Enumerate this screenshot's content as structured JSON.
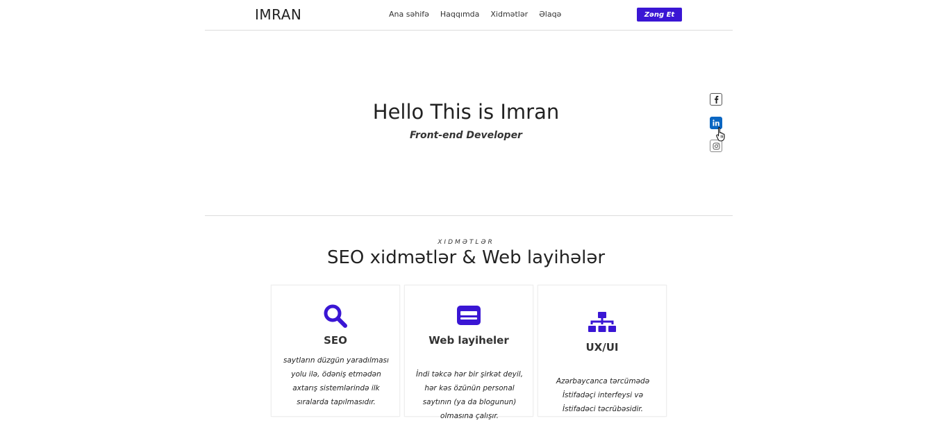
{
  "header": {
    "logo": "IMRAN",
    "nav": [
      "Ana səhifə",
      "Haqqımda",
      "Xidmətlər",
      "Əlaqə"
    ],
    "cta_label": "Zəng Et"
  },
  "hero": {
    "title": "Hello This is Imran",
    "subtitle": "Front-end Developer",
    "social_icons": [
      "facebook-icon",
      "linkedin-icon",
      "instagram-icon"
    ]
  },
  "services": {
    "kicker": "XIDMƏTLƏR",
    "title": "SEO xidmətlər & Web layihələr",
    "cards": [
      {
        "icon": "search-icon",
        "title": "SEO",
        "desc": "saytların düzgün yaradılması yolu ilə, ödəniş etmədən axtarış sistemlərində ilk sıralarda tapılmasıdır."
      },
      {
        "icon": "website-icon",
        "title": "Web layiheler",
        "desc": "İndi təkcə hər bir şirkət deyil, hər kəs özünün personal saytının (ya da blogunun) olmasına çalışır."
      },
      {
        "icon": "sitemap-icon",
        "title": "UX/UI",
        "desc": "Azərbaycanca tərcümədə İstifadəçi interfeysi və İstifadəci təcrübəsidir."
      }
    ]
  },
  "colors": {
    "accent": "#3a16d4",
    "linkedin": "#0a66c2"
  }
}
